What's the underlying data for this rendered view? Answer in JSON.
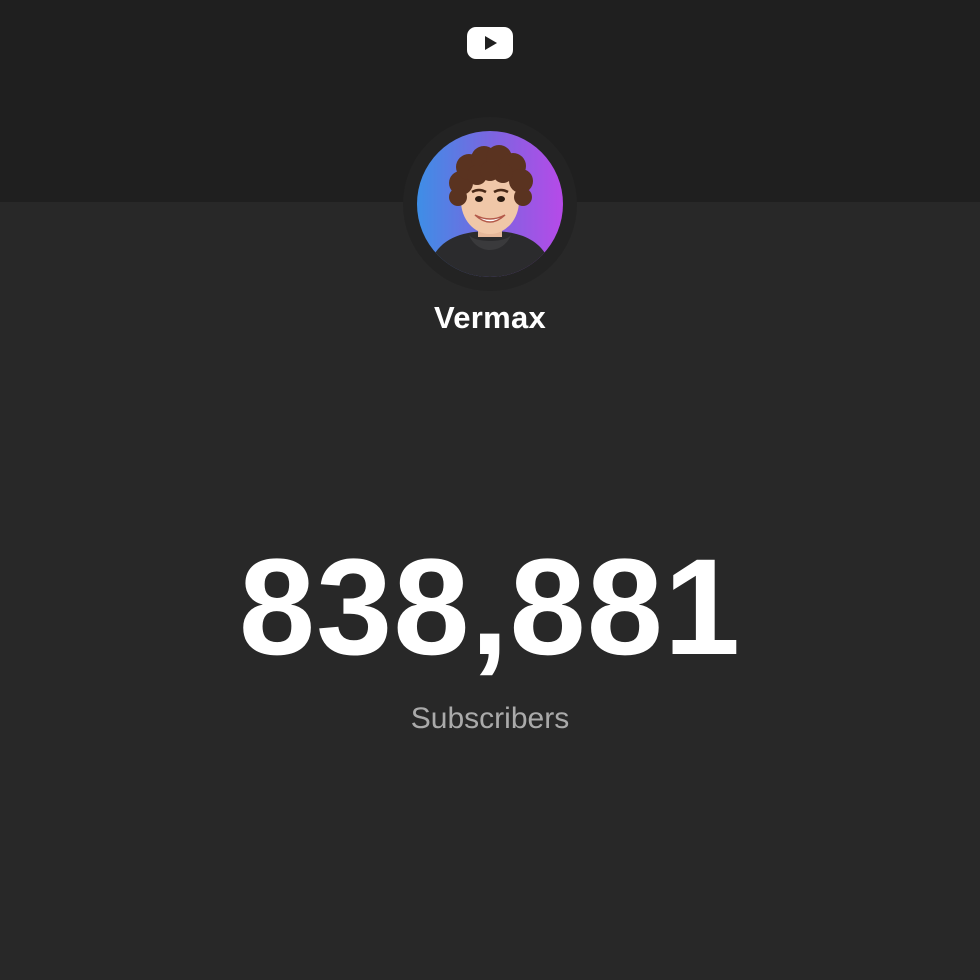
{
  "logo": {
    "icon": "youtube-logo-icon"
  },
  "channel": {
    "avatar_icon": "channel-avatar",
    "name": "Vermax"
  },
  "stats": {
    "subscriber_count": "838,881",
    "subscriber_label": "Subscribers"
  },
  "colors": {
    "background": "#282828",
    "header_band": "#1f1f1f",
    "primary_text": "#ffffff",
    "secondary_text": "#aaaaaa"
  }
}
